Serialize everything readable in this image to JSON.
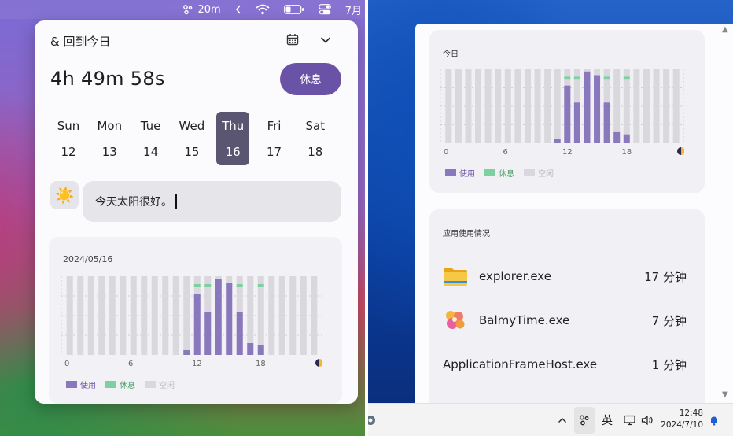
{
  "mac_menubar": {
    "timer": "20m",
    "date_partial": "7月"
  },
  "popover": {
    "title": "& 回到今日",
    "timer": "4h 49m 58s",
    "rest_button": "休息",
    "week": [
      {
        "dow": "Sun",
        "date": "12",
        "selected": false
      },
      {
        "dow": "Mon",
        "date": "13",
        "selected": false
      },
      {
        "dow": "Tue",
        "date": "14",
        "selected": false
      },
      {
        "dow": "Wed",
        "date": "15",
        "selected": false
      },
      {
        "dow": "Thu",
        "date": "16",
        "selected": true
      },
      {
        "dow": "Fri",
        "date": "17",
        "selected": false
      },
      {
        "dow": "Sat",
        "date": "18",
        "selected": false
      }
    ],
    "mood_emoji": "☀️",
    "mood_text": "今天太阳很好。",
    "day_card_date": "2024/05/16"
  },
  "windows": {
    "today_label": "今日",
    "apps_title": "应用使用情况",
    "apps": [
      {
        "name": "explorer.exe",
        "time": "17 分钟",
        "icon": "folder-icon"
      },
      {
        "name": "BalmyTime.exe",
        "time": "7 分钟",
        "icon": "balmytime-icon"
      },
      {
        "name": "ApplicationFrameHost.exe",
        "time": "1 分钟",
        "icon": "none"
      }
    ],
    "taskbar": {
      "ime": "英",
      "time": "12:48",
      "date": "2024/7/10"
    }
  },
  "colors": {
    "use": "#8a78bd",
    "rest": "#7fd0a0",
    "idle": "#d9d8dd",
    "accent": "#6a52a7"
  },
  "chart_data": [
    {
      "type": "bar",
      "title": "2024/05/16",
      "x_ticks": [
        "0",
        "6",
        "12",
        "18"
      ],
      "legend": [
        "使用",
        "休息",
        "空闲"
      ],
      "x": [
        0,
        1,
        2,
        3,
        4,
        5,
        6,
        7,
        8,
        9,
        10,
        11,
        12,
        13,
        14,
        15,
        16,
        17,
        18,
        19,
        20,
        21,
        22,
        23
      ],
      "series": [
        {
          "name": "使用",
          "values": [
            0,
            0,
            0,
            0,
            0,
            0,
            0,
            0,
            0,
            0,
            0,
            0.06,
            0.78,
            0.55,
            0.97,
            0.92,
            0.55,
            0.15,
            0.12,
            0,
            0,
            0,
            0,
            0
          ]
        },
        {
          "name": "休息",
          "values": [
            0,
            0,
            0,
            0,
            0,
            0,
            0,
            0,
            0,
            0,
            0,
            0,
            0.04,
            0.04,
            0.04,
            0.04,
            0.04,
            0,
            0.04,
            0,
            0,
            0,
            0,
            0
          ]
        }
      ]
    },
    {
      "type": "bar",
      "title": "今日",
      "x_ticks": [
        "0",
        "6",
        "12",
        "18"
      ],
      "legend": [
        "使用",
        "休息",
        "空闲"
      ],
      "x": [
        0,
        1,
        2,
        3,
        4,
        5,
        6,
        7,
        8,
        9,
        10,
        11,
        12,
        13,
        14,
        15,
        16,
        17,
        18,
        19,
        20,
        21,
        22,
        23
      ],
      "series": [
        {
          "name": "使用",
          "values": [
            0,
            0,
            0,
            0,
            0,
            0,
            0,
            0,
            0,
            0,
            0,
            0.06,
            0.78,
            0.55,
            0.97,
            0.92,
            0.55,
            0.15,
            0.12,
            0,
            0,
            0,
            0,
            0
          ]
        },
        {
          "name": "休息",
          "values": [
            0,
            0,
            0,
            0,
            0,
            0,
            0,
            0,
            0,
            0,
            0,
            0,
            0.04,
            0.04,
            0.04,
            0.04,
            0.04,
            0,
            0.04,
            0,
            0,
            0,
            0,
            0
          ]
        }
      ]
    }
  ]
}
